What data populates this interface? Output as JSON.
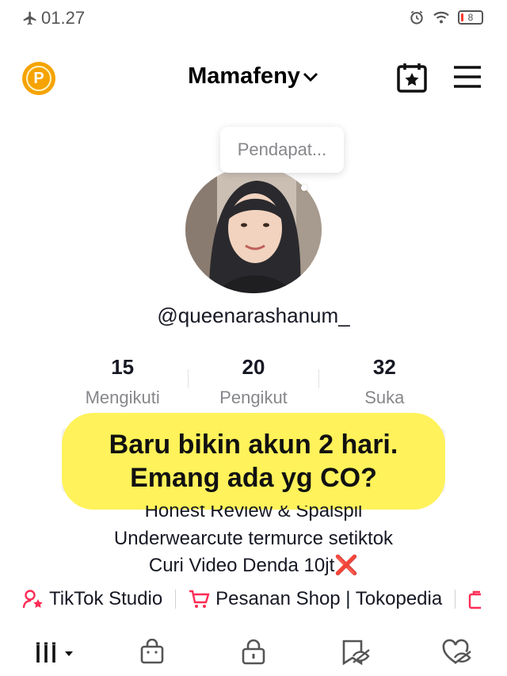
{
  "status_bar": {
    "time": "01.27",
    "battery": "8"
  },
  "header": {
    "title": "Mamafeny",
    "coin_letter": "P"
  },
  "profile": {
    "bubble_text": "Pendapat...",
    "username": "@queenarashanum_"
  },
  "stats": [
    {
      "value": "15",
      "label": "Mengikuti"
    },
    {
      "value": "20",
      "label": "Pengikut"
    },
    {
      "value": "32",
      "label": "Suka"
    }
  ],
  "banner": {
    "line1": "Baru bikin akun 2 hari.",
    "line2": "Emang ada yg CO?"
  },
  "bio": {
    "line1": "Honest Review & Spalspil",
    "line2": "Underwearcute termurce setiktok",
    "line3": "Curi Video Denda 10jt",
    "line3_emoji": "❌"
  },
  "shortcuts": {
    "studio": "TikTok Studio",
    "shop": "Pesanan Shop | Tokopedia"
  },
  "colors": {
    "accent_pink": "#fe2c55",
    "coin": "#f5a300",
    "banner": "#fff25a"
  }
}
